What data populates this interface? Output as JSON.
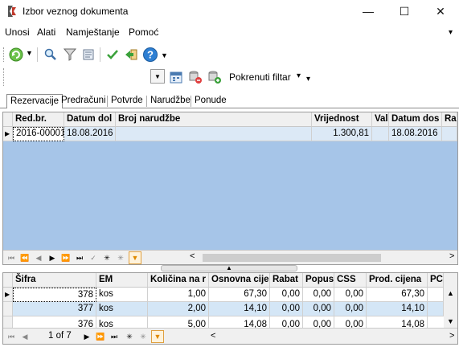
{
  "window": {
    "title": "Izbor veznog dokumenta",
    "minimize": "—",
    "maximize": "☐",
    "close": "✕"
  },
  "menu": {
    "items": [
      "Unosi",
      "Alati",
      "Namještanje",
      "Pomoć"
    ],
    "overflow": "▾"
  },
  "toolbar2": {
    "filter_label": "Pokrenuti filtar",
    "filter_arrow": "▾",
    "overflow": "▾",
    "dropdown_arrow": "▼"
  },
  "tabs": [
    "Rezervacije",
    "Predračuni",
    "Potvrde",
    "Narudžbe",
    "Ponude"
  ],
  "top_grid": {
    "columns": [
      "Red.br.",
      "Datum dol",
      "Broj narudžbe",
      "Vrijednost",
      "Val",
      "Datum dos",
      "Ra"
    ],
    "rows": [
      [
        "2016-00001",
        "18.08.2016",
        "",
        "1.300,81",
        "",
        "18.08.2016",
        ""
      ]
    ]
  },
  "bottom_grid": {
    "columns": [
      "Šifra",
      "EM",
      "Količina na r",
      "Osnovna cije",
      "Rabat",
      "Popus",
      "CSS",
      "Prod. cijena",
      "PC"
    ],
    "rows": [
      [
        "378",
        "kos",
        "1,00",
        "67,30",
        "0,00",
        "0,00",
        "0,00",
        "67,30"
      ],
      [
        "377",
        "kos",
        "2,00",
        "14,10",
        "0,00",
        "0,00",
        "0,00",
        "14,10"
      ],
      [
        "376",
        "kos",
        "5,00",
        "14,08",
        "0,00",
        "0,00",
        "0,00",
        "14,08"
      ]
    ],
    "pager": "1 of 7"
  },
  "colors": {
    "accent_blue": "#a6c5e8",
    "row_alt_blue": "#d4e6f6",
    "selected_row": "#dce9f6",
    "filter_orange": "#f5a623"
  },
  "icons": [
    "app-icon",
    "refresh-icon",
    "search-icon",
    "funnel-icon",
    "edit-filter-icon",
    "check-icon",
    "import-icon",
    "help-icon",
    "calendar-icon",
    "db-remove-icon",
    "db-add-icon"
  ]
}
